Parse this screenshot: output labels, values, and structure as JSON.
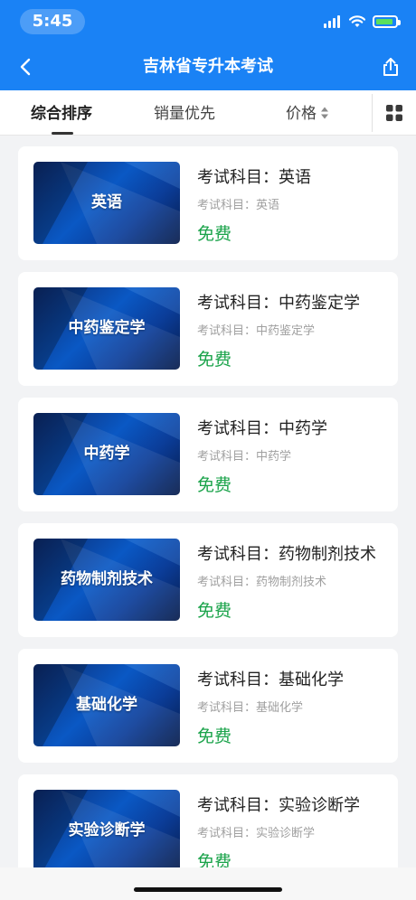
{
  "status_bar": {
    "time": "5:45",
    "icons": [
      "signal-icon",
      "wifi-icon",
      "battery-charging-icon"
    ]
  },
  "nav": {
    "title": "吉林省专升本考试",
    "back_icon": "chevron-left-icon",
    "share_icon": "share-icon"
  },
  "sort_tabs": [
    {
      "label": "综合排序",
      "active": true
    },
    {
      "label": "销量优先",
      "active": false
    },
    {
      "label": "价格",
      "active": false
    }
  ],
  "layout_toggle_icon": "grid-icon",
  "items": [
    {
      "thumb_text": "英语",
      "title": "考试科目：英语",
      "subtitle": "考试科目：英语",
      "price": "免费"
    },
    {
      "thumb_text": "中药鉴定学",
      "title": "考试科目：中药鉴定学",
      "subtitle": "考试科目：中药鉴定学",
      "price": "免费"
    },
    {
      "thumb_text": "中药学",
      "title": "考试科目：中药学",
      "subtitle": "考试科目：中药学",
      "price": "免费"
    },
    {
      "thumb_text": "药物制剂技术",
      "title": "考试科目：药物制剂技术",
      "subtitle": "考试科目：药物制剂技术",
      "price": "免费"
    },
    {
      "thumb_text": "基础化学",
      "title": "考试科目：基础化学",
      "subtitle": "考试科目：基础化学",
      "price": "免费"
    },
    {
      "thumb_text": "实验诊断学",
      "title": "考试科目：实验诊断学",
      "subtitle": "考试科目：实验诊断学",
      "price": "免费"
    }
  ],
  "colors": {
    "brand_blue": "#1a82f5",
    "price_green": "#1aa34a",
    "page_bg": "#f2f3f5"
  }
}
